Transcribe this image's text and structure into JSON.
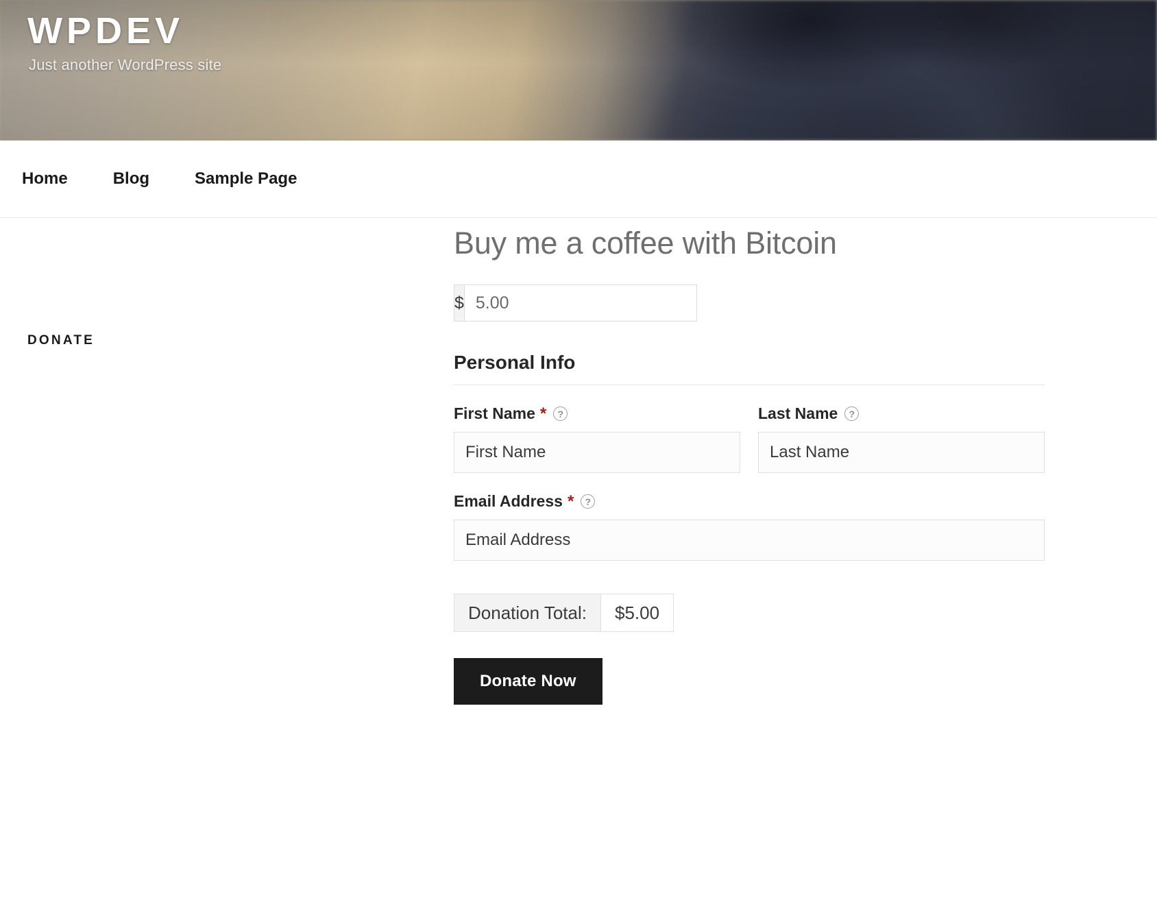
{
  "site": {
    "title": "WPDEV",
    "description": "Just another WordPress site"
  },
  "nav": {
    "items": [
      {
        "label": "Home"
      },
      {
        "label": "Blog"
      },
      {
        "label": "Sample Page"
      }
    ]
  },
  "page": {
    "label": "DONATE"
  },
  "form": {
    "title": "Buy me a coffee with Bitcoin",
    "currency_symbol": "$",
    "amount_value": "5.00",
    "section_legend": "Personal Info",
    "fields": {
      "first_name": {
        "label": "First Name",
        "required_mark": "*",
        "help_icon": "?",
        "placeholder": "First Name",
        "value": ""
      },
      "last_name": {
        "label": "Last Name",
        "help_icon": "?",
        "placeholder": "Last Name",
        "value": ""
      },
      "email": {
        "label": "Email Address",
        "required_mark": "*",
        "help_icon": "?",
        "placeholder": "Email Address",
        "value": ""
      }
    },
    "total_label": "Donation Total:",
    "total_amount": "$5.00",
    "submit_label": "Donate Now"
  },
  "colors": {
    "button_background": "#1c1c1c",
    "required_asterisk": "#a81c1c",
    "heading_gray": "#6f6f6f"
  }
}
